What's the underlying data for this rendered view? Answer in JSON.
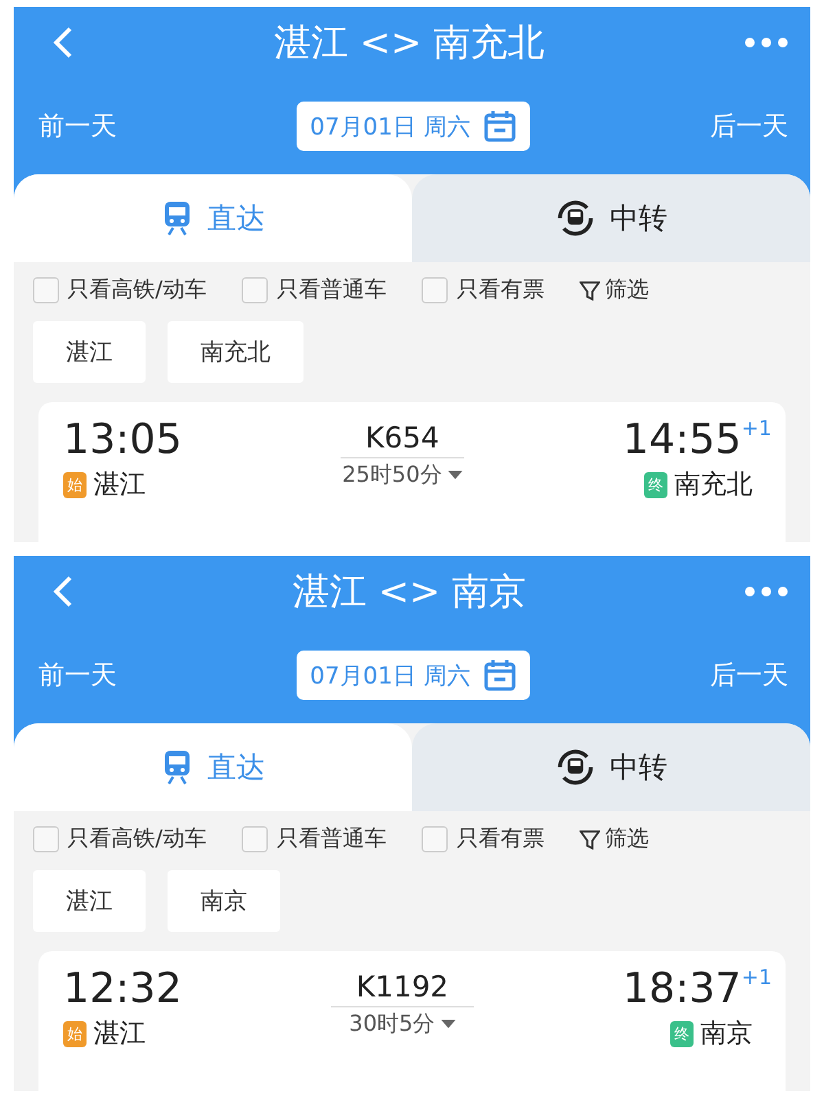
{
  "panels": [
    {
      "title": "湛江 <> 南充北",
      "prev_day": "前一天",
      "date": "07月01日 周六",
      "next_day": "后一天",
      "tabs": [
        {
          "label": "直达",
          "kind": "direct",
          "selected": true
        },
        {
          "label": "中转",
          "kind": "transfer",
          "selected": false
        }
      ],
      "filters": [
        {
          "label": "只看高铁/动车",
          "checked": false
        },
        {
          "label": "只看普通车",
          "checked": false
        },
        {
          "label": "只看有票",
          "checked": false
        }
      ],
      "filter_button": "筛选",
      "stations": [
        "湛江",
        "南充北"
      ],
      "train": {
        "depart_time": "13:05",
        "from_badge": "始",
        "from": "湛江",
        "number": "K654",
        "duration": "25时50分",
        "arrive_time": "14:55",
        "day_offset": "+1",
        "to_badge": "终",
        "to": "南充北"
      }
    },
    {
      "title": "湛江 <> 南京",
      "prev_day": "前一天",
      "date": "07月01日 周六",
      "next_day": "后一天",
      "tabs": [
        {
          "label": "直达",
          "kind": "direct",
          "selected": true
        },
        {
          "label": "中转",
          "kind": "transfer",
          "selected": false
        }
      ],
      "filters": [
        {
          "label": "只看高铁/动车",
          "checked": false
        },
        {
          "label": "只看普通车",
          "checked": false
        },
        {
          "label": "只看有票",
          "checked": false
        }
      ],
      "filter_button": "筛选",
      "stations": [
        "湛江",
        "南京"
      ],
      "train": {
        "depart_time": "12:32",
        "from_badge": "始",
        "from": "湛江",
        "number": "K1192",
        "duration": "30时5分",
        "arrive_time": "18:37",
        "day_offset": "+1",
        "to_badge": "终",
        "to": "南京"
      }
    }
  ]
}
